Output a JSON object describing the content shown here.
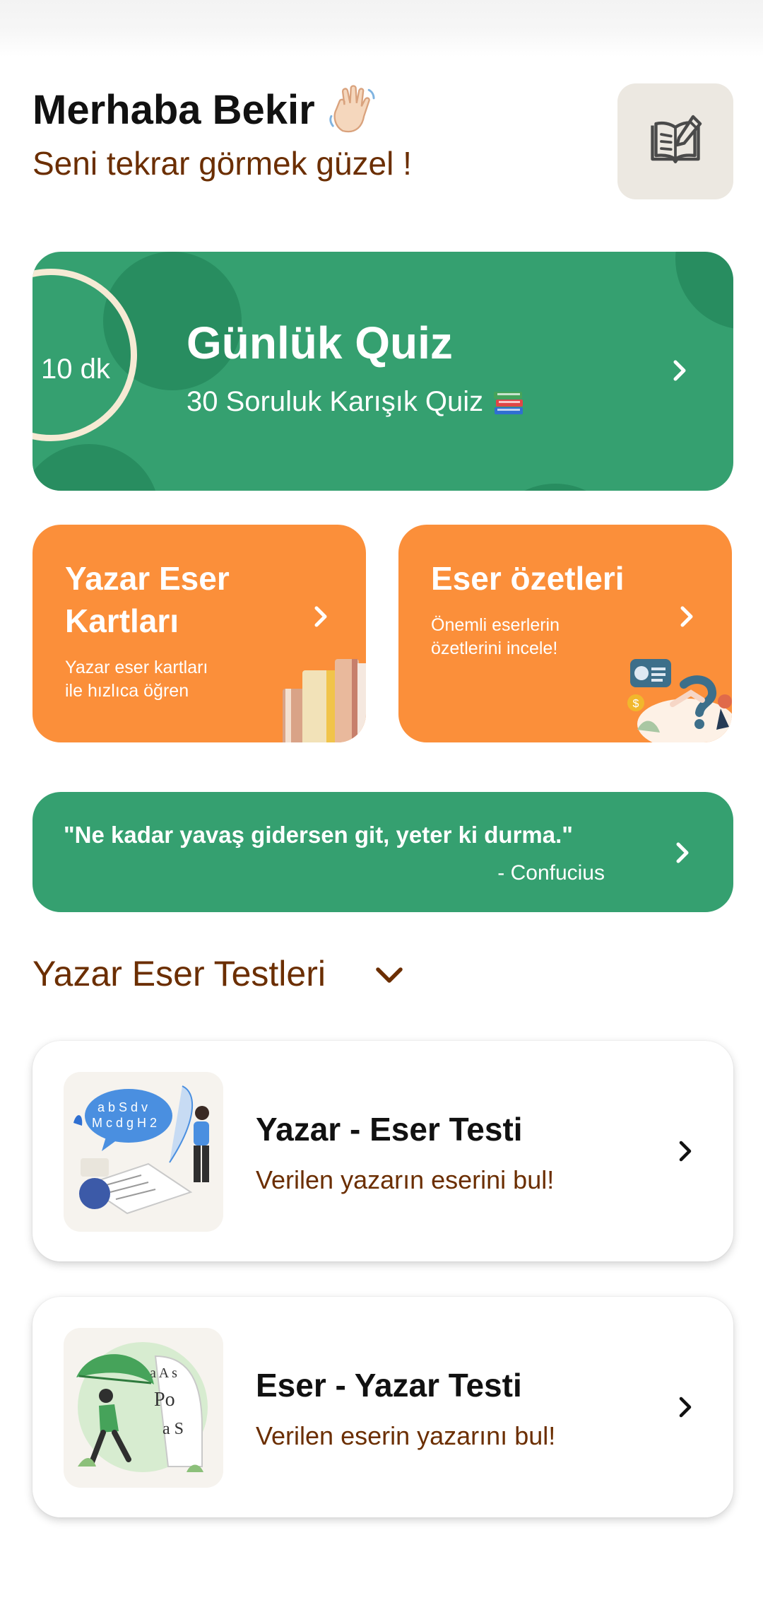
{
  "header": {
    "greeting": "Merhaba Bekir",
    "greeting_emoji": "waving-hand",
    "subtitle": "Seni tekrar görmek güzel !",
    "edit_icon": "book-pencil-icon"
  },
  "daily_quiz": {
    "timer": "10 dk",
    "title": "Günlük Quiz",
    "subtitle": "30 Soruluk Karışık Quiz",
    "subtitle_emoji": "books"
  },
  "cards": [
    {
      "title_line1": "Yazar Eser",
      "title_line2": "Kartları",
      "desc_line1": "Yazar eser kartları",
      "desc_line2": "ile hızlıca öğren",
      "illustration": "books-stack"
    },
    {
      "title": "Eser özetleri",
      "desc_line1": "Önemli eserlerin",
      "desc_line2": "özetlerini incele!",
      "illustration": "summary-people"
    }
  ],
  "quote": {
    "text": "\"Ne kadar yavaş gidersen git, yeter ki durma.\"",
    "author": "- Confucius"
  },
  "section": {
    "title": "Yazar Eser Testleri",
    "toggle_icon": "chevron-down-icon"
  },
  "tests": [
    {
      "title": "Yazar - Eser Testi",
      "desc": "Verilen yazarın eserini bul!",
      "thumb": "writer-quill-illustration"
    },
    {
      "title": "Eser - Yazar Testi",
      "desc": "Verilen eserin yazarını bul!",
      "thumb": "reader-leaf-illustration"
    }
  ],
  "colors": {
    "green": "#35a070",
    "orange": "#fb8f3a",
    "brown_text": "#6b2e00",
    "ring": "#f6ead4"
  }
}
